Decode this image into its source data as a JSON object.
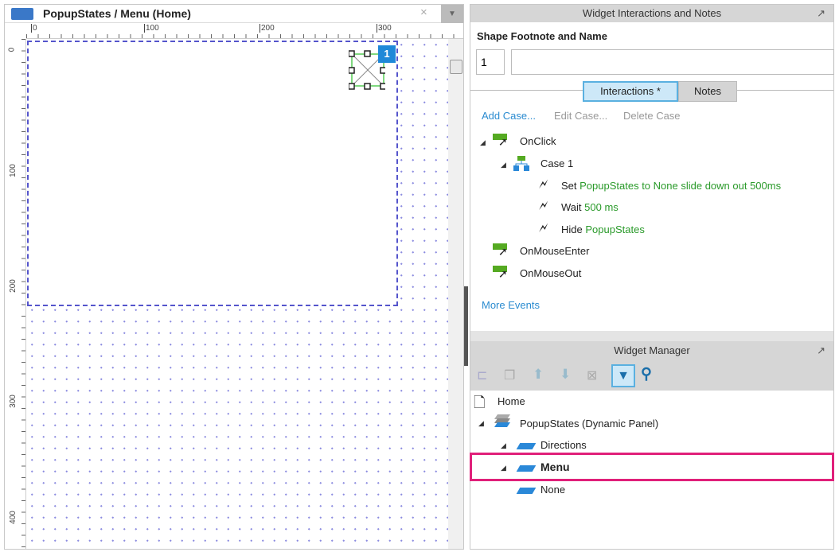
{
  "canvas_panel": {
    "title": "PopupStates / Menu (Home)",
    "close": "×",
    "menu": "▼",
    "ruler_h": [
      "0",
      "100",
      "200",
      "300"
    ],
    "ruler_v": [
      "0",
      "100",
      "200",
      "300",
      "400"
    ],
    "footnote_badge": "1"
  },
  "interactions_panel": {
    "title": "Widget Interactions and Notes",
    "section_label": "Shape Footnote and Name",
    "footnote_value": "1",
    "name_value": "",
    "tabs": [
      {
        "label": "Interactions *",
        "active": true
      },
      {
        "label": "Notes",
        "active": false
      }
    ],
    "actions": {
      "add": "Add Case...",
      "edit": "Edit Case...",
      "delete": "Delete Case"
    },
    "tree": {
      "onclick": "OnClick",
      "case": "Case 1",
      "steps": [
        {
          "verb": "Set",
          "detail": "PopupStates to None slide down out 500ms"
        },
        {
          "verb": "Wait",
          "detail": "500 ms"
        },
        {
          "verb": "Hide",
          "detail": "PopupStates"
        }
      ],
      "onmouseenter": "OnMouseEnter",
      "onmouseout": "OnMouseOut"
    },
    "more_events": "More Events"
  },
  "widget_manager": {
    "title": "Widget Manager",
    "toolbar": [
      "add-page-icon",
      "duplicate-icon",
      "move-up-icon",
      "move-down-icon",
      "delete-icon",
      "filter-icon",
      "search-icon"
    ],
    "tree": {
      "page": "Home",
      "panel": "PopupStates (Dynamic Panel)",
      "states": [
        "Directions",
        "Menu",
        "None"
      ],
      "selected": "Menu"
    }
  },
  "colors": {
    "accent": "#2a8bd0",
    "highlight": "#e0207a",
    "event_green": "#55aa22",
    "action_green": "#2a9a2a"
  }
}
